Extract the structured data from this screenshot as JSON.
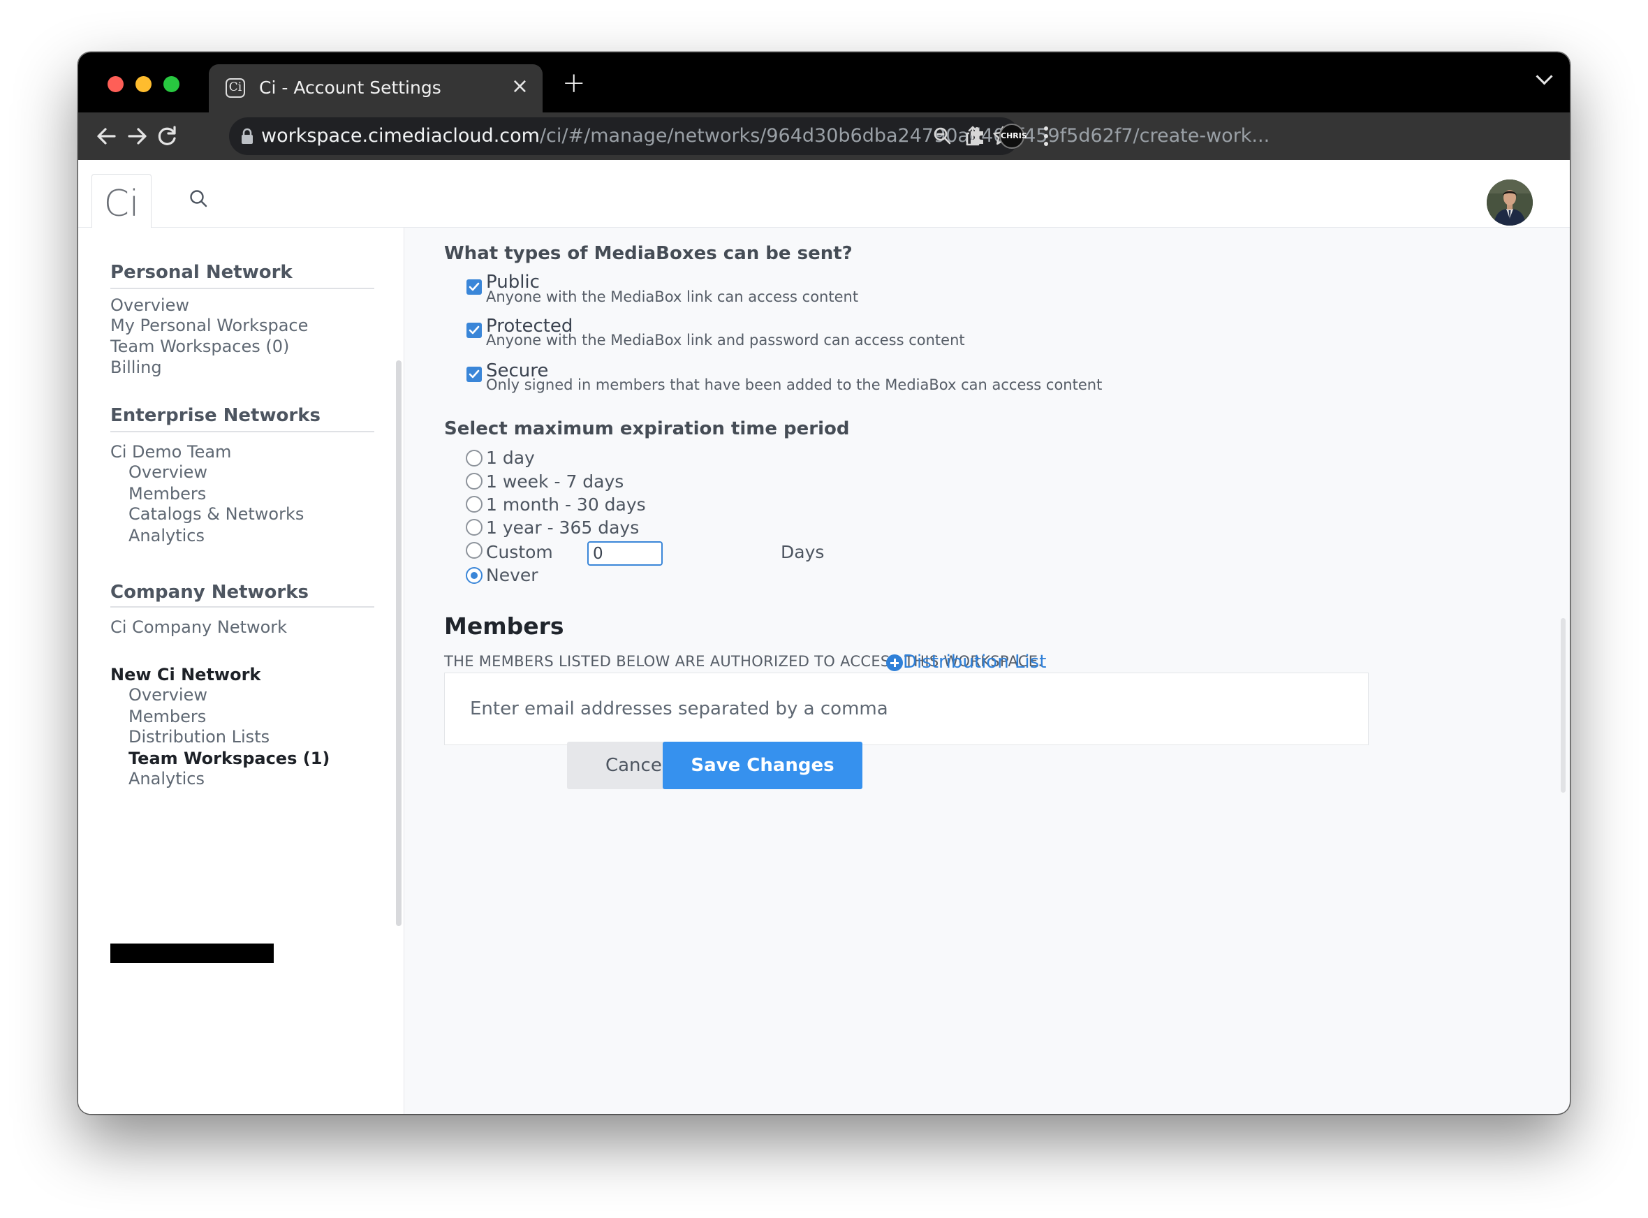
{
  "browser": {
    "tab_title": "Ci - Account Settings",
    "tab_favicon": "Ci",
    "url_host": "workspace.cimediacloud.com",
    "url_path": "/ci/#/manage/networks/964d30b6dba24790ad400f459f5d62f7/create-work...",
    "profile_badge": "CHRIS"
  },
  "header": {
    "logo": "Ci"
  },
  "sidebar": {
    "personal": {
      "title": "Personal Network",
      "items": [
        "Overview",
        "My Personal Workspace",
        "Team Workspaces (0)",
        "Billing"
      ]
    },
    "enterprise": {
      "title": "Enterprise Networks",
      "team": "Ci Demo Team",
      "items": [
        "Overview",
        "Members",
        "Catalogs & Networks",
        "Analytics"
      ]
    },
    "company": {
      "title": "Company Networks",
      "network": "Ci Company Network",
      "active_network": "New Ci Network",
      "items": [
        "Overview",
        "Members",
        "Distribution Lists",
        "Team Workspaces (1)",
        "Analytics"
      ]
    }
  },
  "mediaboxes": {
    "question": "What types of MediaBoxes can be sent?",
    "options": [
      {
        "title": "Public",
        "desc": "Anyone with the MediaBox link can access content",
        "checked": true
      },
      {
        "title": "Protected",
        "desc": "Anyone with the MediaBox link and password can access content",
        "checked": true
      },
      {
        "title": "Secure",
        "desc": "Only signed in members that have been added to the MediaBox can access content",
        "checked": true
      }
    ]
  },
  "expiration": {
    "question": "Select maximum expiration time period",
    "options": [
      "1 day",
      "1 week - 7 days",
      "1 month - 30 days",
      "1 year - 365 days",
      "Custom",
      "Never"
    ],
    "selected": "Never",
    "custom_value": "0",
    "custom_unit": "Days"
  },
  "members": {
    "title": "Members",
    "note": "THE MEMBERS LISTED BELOW ARE AUTHORIZED TO ACCESS THIS WORKSPACE.",
    "distribution_link": "Distribution List",
    "email_placeholder": "Enter email addresses separated by a comma"
  },
  "actions": {
    "cancel": "Cancel",
    "save": "Save Changes"
  },
  "colors": {
    "accent": "#3691ee",
    "checkbox": "#3a86d8",
    "link": "#2f80d8"
  }
}
